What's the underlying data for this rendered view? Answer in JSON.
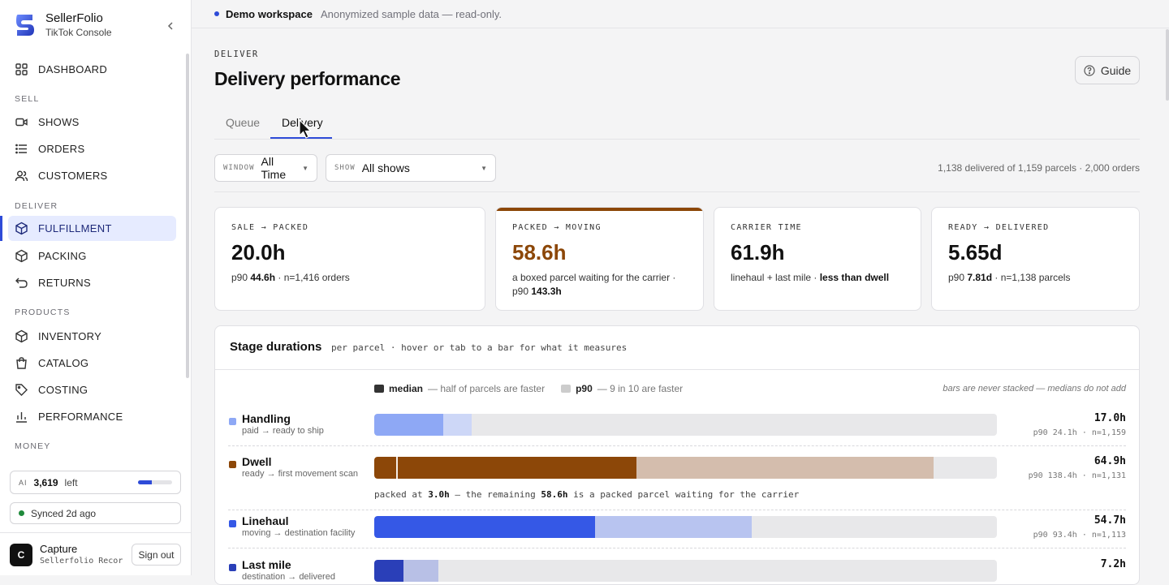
{
  "brand": {
    "name": "SellerFolio",
    "sub": "TikTok Console"
  },
  "sidebar": {
    "top_item": {
      "label": "DASHBOARD",
      "icon": "grid-icon"
    },
    "sections": [
      {
        "title": "SELL",
        "items": [
          {
            "label": "SHOWS",
            "icon": "video-icon"
          },
          {
            "label": "ORDERS",
            "icon": "list-icon"
          },
          {
            "label": "CUSTOMERS",
            "icon": "users-icon"
          }
        ]
      },
      {
        "title": "DELIVER",
        "items": [
          {
            "label": "FULFILLMENT",
            "icon": "box-icon",
            "active": true
          },
          {
            "label": "PACKING",
            "icon": "box-icon"
          },
          {
            "label": "RETURNS",
            "icon": "return-icon"
          }
        ]
      },
      {
        "title": "PRODUCTS",
        "items": [
          {
            "label": "INVENTORY",
            "icon": "box-icon"
          },
          {
            "label": "CATALOG",
            "icon": "bag-icon"
          },
          {
            "label": "COSTING",
            "icon": "tag-icon"
          },
          {
            "label": "PERFORMANCE",
            "icon": "bar-chart-icon"
          }
        ]
      },
      {
        "title": "MONEY",
        "items": []
      }
    ],
    "ai": {
      "tag": "AI",
      "value": "3,619",
      "label": "left",
      "fraction": 0.4
    },
    "sync": "Synced 2d ago",
    "user": {
      "initial": "C",
      "name": "Capture",
      "sub": "Sellerfolio Recor…",
      "signout": "Sign out"
    }
  },
  "topbar": {
    "workspace": "Demo workspace",
    "note": "Anonymized sample data — read-only."
  },
  "header": {
    "eyebrow": "DELIVER",
    "title": "Delivery performance",
    "guide": "Guide"
  },
  "tabs": [
    {
      "label": "Queue"
    },
    {
      "label": "Delivery",
      "active": true
    }
  ],
  "filters": {
    "window": {
      "tag": "WINDOW",
      "value": "All Time"
    },
    "show": {
      "tag": "SHOW",
      "value": "All shows"
    },
    "summary": "1,138 delivered of 1,159 parcels · 2,000 orders"
  },
  "kpis": [
    {
      "label": "SALE → PACKED",
      "value": "20.0h",
      "note_pre": "p90 ",
      "note_bold": "44.6h",
      "note_post": " · n=1,416 orders"
    },
    {
      "label": "PACKED → MOVING",
      "value": "58.6h",
      "note_pre": "a boxed parcel waiting for the carrier · p90 ",
      "note_bold": "143.3h",
      "note_post": "",
      "highlight": true
    },
    {
      "label": "CARRIER TIME",
      "value": "61.9h",
      "note_pre": "linehaul + last mile · ",
      "note_bold": "less than dwell",
      "note_post": ""
    },
    {
      "label": "READY → DELIVERED",
      "value": "5.65d",
      "note_pre": "p90 ",
      "note_bold": "7.81d",
      "note_post": " · n=1,138 parcels"
    }
  ],
  "stages_panel": {
    "title": "Stage durations",
    "subtitle": "per parcel · hover or tab to a bar for what it measures",
    "legend": {
      "median_label": "median",
      "median_note": "— half of parcels are faster",
      "p90_label": "p90",
      "p90_note": "— 9 in 10 are faster",
      "right_note": "bars are never stacked — medians do not add"
    },
    "scale_max_hours": 154,
    "stages": [
      {
        "name": "Handling",
        "desc": "paid → ready to ship",
        "median_h": 17.0,
        "p90_h": 24.1,
        "value": "17.0h",
        "meta": "p90 24.1h · n=1,159",
        "color": "#8ea8f5",
        "p90_color": "#cdd7f7"
      },
      {
        "name": "Dwell",
        "desc": "ready → first movement scan",
        "median_h": 64.9,
        "p90_h": 138.4,
        "value": "64.9h",
        "meta": "p90 138.4h · n=1,131",
        "color": "#8c4708",
        "p90_color": "#d4bdad",
        "packed_h": 3.0
      },
      {
        "name": "Linehaul",
        "desc": "moving → destination facility",
        "median_h": 54.7,
        "p90_h": 93.4,
        "value": "54.7h",
        "meta": "p90 93.4h · n=1,113",
        "color": "#3558e6",
        "p90_color": "#b8c4f0"
      },
      {
        "name": "Last mile",
        "desc": "destination → delivered",
        "median_h": 7.2,
        "p90_h": 15.8,
        "value": "7.2h",
        "meta": "",
        "color": "#2a3fb8",
        "p90_color": "#b8c0e6"
      }
    ],
    "dwell_note": {
      "a": "packed at ",
      "b": "3.0h",
      "c": " — the remaining ",
      "d": "58.6h",
      "e": " is a packed parcel waiting for the carrier"
    }
  }
}
